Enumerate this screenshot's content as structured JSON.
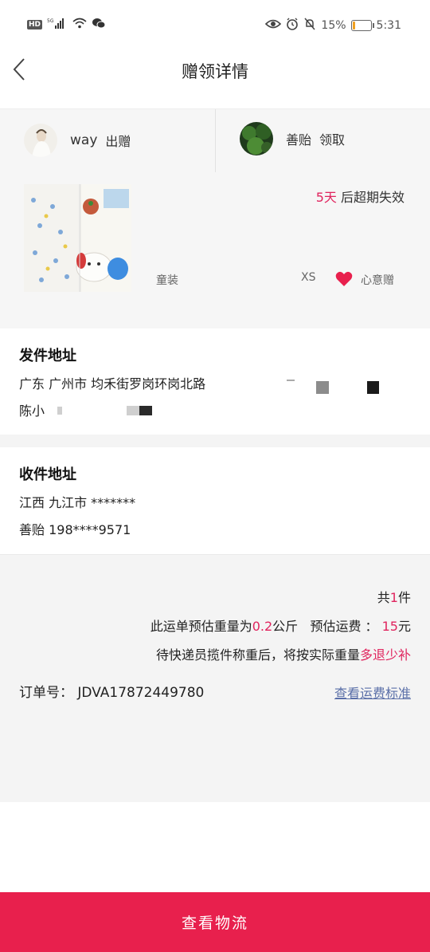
{
  "status_bar": {
    "hd_label": "HD",
    "battery_percent": "15%",
    "battery_level": 0.15,
    "time": "5:31"
  },
  "header": {
    "title": "赠领详情"
  },
  "giver": {
    "name": "way",
    "action": "出赠"
  },
  "receiver": {
    "name": "善贻",
    "action": "领取"
  },
  "item": {
    "expire_days": "5天",
    "expire_suffix": "后超期失效",
    "category": "童装",
    "size": "XS",
    "gift_type": "心意赠"
  },
  "sender_address": {
    "title": "发件地址",
    "address": "广东  广州市  均禾街罗岗环岗北路",
    "contact": "陈小"
  },
  "receiver_address": {
    "title": "收件地址",
    "address": "江西  九江市  *******",
    "contact": "善贻  198****9571"
  },
  "summary": {
    "total_prefix": "共",
    "total_count": "1",
    "total_suffix": "件",
    "weight_prefix": "此运单预估重量为",
    "weight_value": "0.2",
    "weight_unit": "公斤",
    "fee_label": "预估运费 ：",
    "fee_value": "15",
    "fee_unit": "元",
    "note_prefix": "待快递员揽件称重后，将按实际重量",
    "note_highlight": "多退少补",
    "order_label": "订单号：",
    "order_number": "JDVA17872449780",
    "fee_standard_link": "查看运费标准"
  },
  "footer": {
    "button_label": "查看物流"
  },
  "colors": {
    "accent": "#e8204d",
    "highlight": "#e0245e",
    "link": "#5a6fa8"
  }
}
